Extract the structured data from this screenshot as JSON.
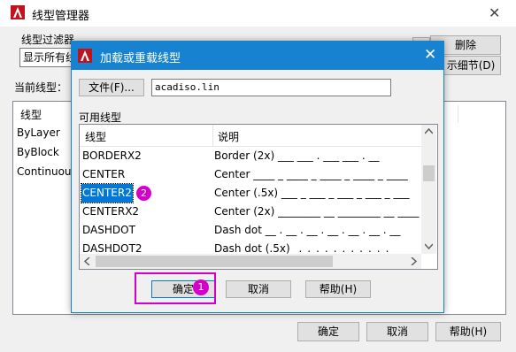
{
  "parent": {
    "title": "线型管理器",
    "close_glyph": "✕",
    "filter_label": "线型过滤器",
    "filter_value": "显示所有线",
    "delete_button": "删除",
    "details_button": "示细节(D)",
    "current_label": "当前线型：",
    "list_header": "线型",
    "list_items": [
      "ByLayer",
      "ByBlock",
      "Continuous"
    ],
    "ok_button": "确定",
    "cancel_button": "取消",
    "help_button": "帮助(H)"
  },
  "child": {
    "title": "加载或重载线型",
    "close_glyph": "✕",
    "file_button": "文件(F)...",
    "file_value": "acadiso.lin",
    "available_label": "可用线型",
    "col_linetype": "线型",
    "col_desc": "说明",
    "rows": [
      {
        "name": "BORDERX2",
        "desc": "Border (2x) ___ ___ . ___ ___ . __",
        "selected": false
      },
      {
        "name": "CENTER",
        "desc": "Center ____ _ ____ _ ____ _ ____ _ ____",
        "selected": false
      },
      {
        "name": "CENTER2",
        "desc": "Center (.5x) ___ _ ___ _ ___ _ ___ _ ___",
        "selected": true
      },
      {
        "name": "CENTERX2",
        "desc": "Center (2x) ________ __ ________ __ ____",
        "selected": false
      },
      {
        "name": "DASHDOT",
        "desc": "Dash dot __ . __ . __ . __ . __ . __ . __",
        "selected": false
      },
      {
        "name": "DASHDOT2",
        "desc": "Dash dot (.5x) _._._._._._._._._._._._",
        "selected": false
      }
    ],
    "ok_button": "确定",
    "cancel_button": "取消",
    "help_button": "帮助(H)"
  },
  "annotations": {
    "marker1": "1",
    "marker2": "2"
  },
  "colors": {
    "accent": "#1783d0",
    "highlight": "#d400c8",
    "selection": "#0078d7"
  }
}
